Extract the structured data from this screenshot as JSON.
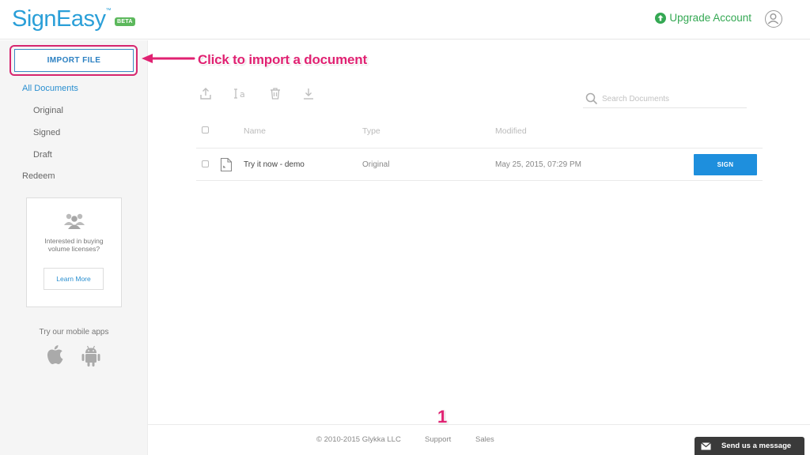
{
  "header": {
    "logo_text": "SignEasy",
    "logo_tm": "™",
    "beta_label": "BETA",
    "upgrade_label": "Upgrade Account"
  },
  "sidebar": {
    "import_label": "IMPORT FILE",
    "nav": {
      "all": "All Documents",
      "original": "Original",
      "signed": "Signed",
      "draft": "Draft",
      "redeem": "Redeem"
    },
    "promo": {
      "text": "Interested in buying volume licenses?",
      "button": "Learn More"
    },
    "mobile_text": "Try our mobile apps"
  },
  "annotation": {
    "text": "Click to import a document",
    "step_number": "1"
  },
  "search": {
    "placeholder": "Search Documents"
  },
  "table": {
    "headers": {
      "name": "Name",
      "type": "Type",
      "modified": "Modified"
    },
    "rows": [
      {
        "name": "Try it now - demo",
        "type": "Original",
        "modified": "May 25, 2015, 07:29 PM",
        "action": "SIGN"
      }
    ]
  },
  "footer": {
    "copyright": "© 2010-2015 Glykka LLC",
    "support": "Support",
    "sales": "Sales"
  },
  "chat": {
    "label": "Send us a message"
  },
  "colors": {
    "brand": "#2a9fd8",
    "upgrade_green": "#34a853",
    "highlight_pink": "#d6266f",
    "sign_blue": "#1e8fdd"
  }
}
